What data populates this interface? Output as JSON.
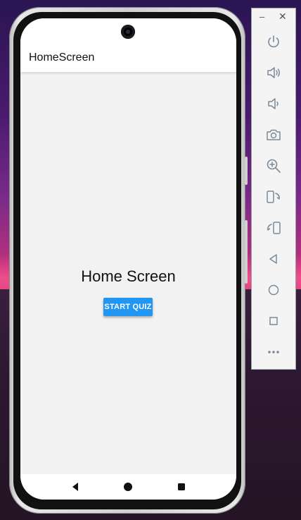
{
  "app": {
    "app_bar_title": "HomeScreen",
    "screen_heading": "Home Screen",
    "start_button_label": "START QUIZ"
  },
  "emulator_panel": {
    "minimize_label": "–",
    "close_label": "✕",
    "tools": [
      "power-icon",
      "volume-up-icon",
      "volume-down-icon",
      "camera-icon",
      "zoom-icon",
      "rotate-left-icon",
      "rotate-right-icon",
      "back-icon",
      "home-icon",
      "overview-icon",
      "more-icon"
    ]
  },
  "nav_bar": {
    "buttons": [
      "back-icon",
      "home-icon",
      "recents-icon"
    ]
  },
  "colors": {
    "accent": "#2196f3",
    "screen_bg": "#f2f2f2",
    "icon_gray": "#7a8a99"
  }
}
